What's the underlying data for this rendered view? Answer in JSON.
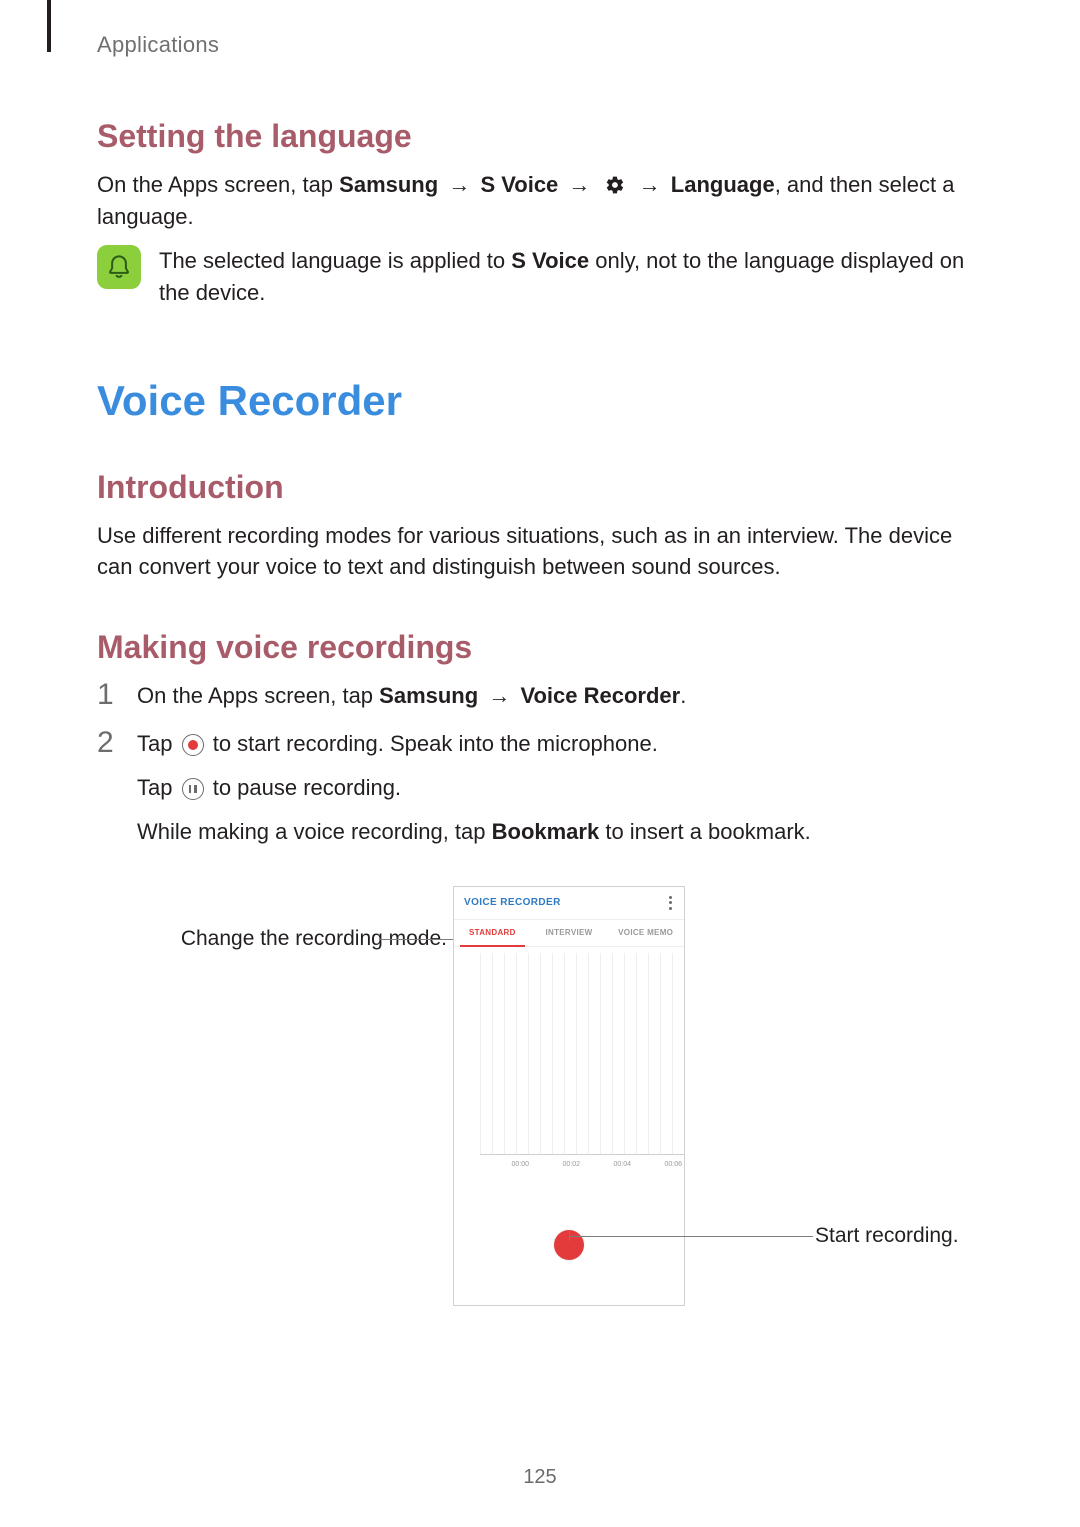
{
  "breadcrumb": "Applications",
  "section1": {
    "heading": "Setting the language",
    "p1_a": "On the Apps screen, tap ",
    "p1_b": "Samsung",
    "p1_c": "S Voice",
    "p1_d": "Language",
    "p1_e": ", and then select a language.",
    "arrow": "→",
    "note_a": "The selected language is applied to ",
    "note_b": "S Voice",
    "note_c": " only, not to the language displayed on the device."
  },
  "main_heading": "Voice Recorder",
  "intro": {
    "heading": "Introduction",
    "body": "Use different recording modes for various situations, such as in an interview. The device can convert your voice to text and distinguish between sound sources."
  },
  "making": {
    "heading": "Making voice recordings",
    "step1_a": "On the Apps screen, tap ",
    "step1_b": "Samsung",
    "step1_c": "Voice Recorder",
    "step1_d": ".",
    "step2_a": "Tap ",
    "step2_b": " to start recording. Speak into the microphone.",
    "step2_c": "Tap ",
    "step2_d": " to pause recording.",
    "step2_e": "While making a voice recording, tap ",
    "step2_f": "Bookmark",
    "step2_g": " to insert a bookmark.",
    "num1": "1",
    "num2": "2"
  },
  "phone": {
    "title": "VOICE RECORDER",
    "tabs": [
      "STANDARD",
      "INTERVIEW",
      "VOICE MEMO"
    ],
    "active_tab": 0,
    "times": [
      "00:00",
      "00:02",
      "00:04",
      "00:06"
    ]
  },
  "callouts": {
    "left": "Change the recording mode.",
    "right": "Start recording."
  },
  "page_number": "125",
  "colors": {
    "maroon": "#a85b69",
    "blue": "#3a8dde",
    "accent_red": "#e33b3b",
    "note_bg": "#8ccf3c"
  }
}
